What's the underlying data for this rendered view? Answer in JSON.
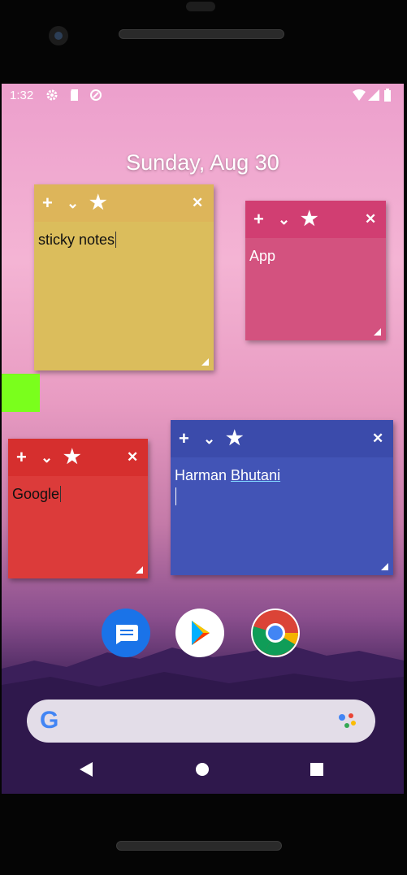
{
  "status_bar": {
    "time": "1:32"
  },
  "date_label": "Sunday, Aug 30",
  "notes": [
    {
      "text": "sticky notes",
      "color": "#dbbd5c",
      "header_color": "#ddb55a"
    },
    {
      "text": "App",
      "color": "#d3527f",
      "header_color": "#d13e72"
    },
    {
      "text": "Google",
      "color": "#dc3b3a",
      "header_color": "#d62f2e"
    },
    {
      "text_first": "Harman ",
      "text_underlined": "Bhutani",
      "color": "#4254b6",
      "header_color": "#3b4bab"
    }
  ],
  "toolbar": {
    "add": "+",
    "collapse": "⌄",
    "star": "★",
    "close": "✕"
  },
  "dock": {
    "apps": [
      {
        "name": "messages-icon"
      },
      {
        "name": "play-store-icon"
      },
      {
        "name": "chrome-icon"
      }
    ]
  },
  "search_bar": {
    "logo": "G"
  },
  "accent_green": "#7aff1c"
}
